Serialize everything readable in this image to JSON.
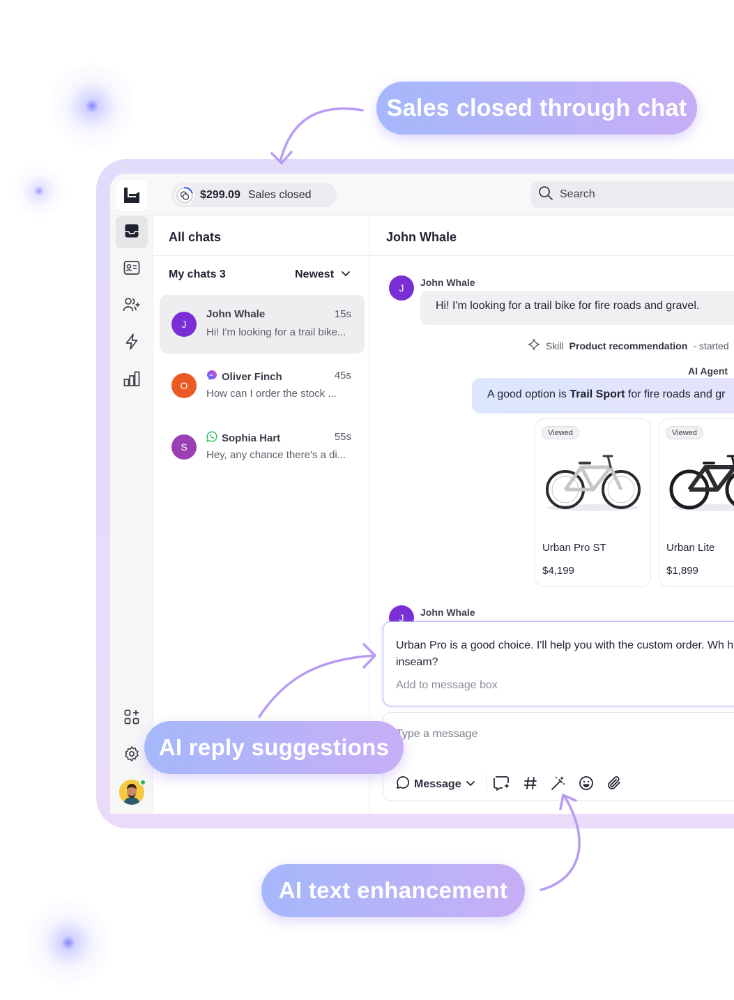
{
  "callouts": {
    "sales": "Sales closed through chat",
    "ai_reply": "AI reply suggestions",
    "ai_text": "AI text enhancement"
  },
  "topbar": {
    "amount": "$299.09",
    "sales_label": "Sales closed",
    "search_placeholder": "Search",
    "icons": [
      "brand-logo-icon",
      "coins-icon",
      "search-icon"
    ]
  },
  "sidebar": {
    "items": [
      {
        "name": "inbox-icon",
        "active": true
      },
      {
        "name": "contact-card-icon",
        "active": false
      },
      {
        "name": "add-user-icon",
        "active": false
      },
      {
        "name": "lightning-icon",
        "active": false
      },
      {
        "name": "bar-chart-icon",
        "active": false
      }
    ],
    "bottom": [
      "apps-add-icon",
      "gear-icon",
      "avatar"
    ],
    "status_color": "#21b65c"
  },
  "chat_list": {
    "title": "All chats",
    "filter_label": "My chats 3",
    "sort_label": "Newest",
    "items": [
      {
        "initial": "J",
        "name": "John Whale",
        "time": "15s",
        "preview": "Hi! I'm looking for a trail bike...",
        "color": "#7a2fd6",
        "channel": ""
      },
      {
        "initial": "O",
        "name": "Oliver Finch",
        "time": "45s",
        "preview": "How can I order the stock ...",
        "color": "#ec5a24",
        "channel": "messenger-icon"
      },
      {
        "initial": "S",
        "name": "Sophia Hart",
        "time": "55s",
        "preview": "Hey, any chance there's a di...",
        "color": "#9b3fb5",
        "channel": "whatsapp-icon"
      }
    ]
  },
  "conversation": {
    "title": "John Whale",
    "customer_initial": "J",
    "customer_name": "John Whale",
    "message_1": "Hi! I'm looking for a trail bike for fire roads and gravel.",
    "skill_prefix": "Skill",
    "skill_name": "Product recommendation",
    "skill_suffix": "- started",
    "agent_label": "AI Agent",
    "agent_pre": "A good option is ",
    "agent_bold": "Trail Sport",
    "agent_post": " for fire roads and gr",
    "products": [
      {
        "badge": "Viewed",
        "name": "Urban Pro ST",
        "price": "$4,199",
        "color": "#c9c4c6"
      },
      {
        "badge": "Viewed",
        "name": "Urban Lite",
        "price": "$1,899",
        "color": "#2b2d30"
      }
    ],
    "customer_name_2": "John Whale",
    "suggestion_text": "Urban Pro is a good choice. I'll help you with the custom order. Wh height and inseam?",
    "suggestion_action": "Add to message box",
    "composer_placeholder": "Type a message",
    "message_type": "Message",
    "tools": [
      "ai-compose-icon",
      "hashtag-icon",
      "magic-wand-icon",
      "emoji-icon",
      "paperclip-icon"
    ]
  },
  "colors": {
    "accent_purple": "#7a2fd6",
    "callout_start": "#a5b8fb",
    "callout_end": "#c7aef6",
    "frame": "#e4dcfb"
  }
}
